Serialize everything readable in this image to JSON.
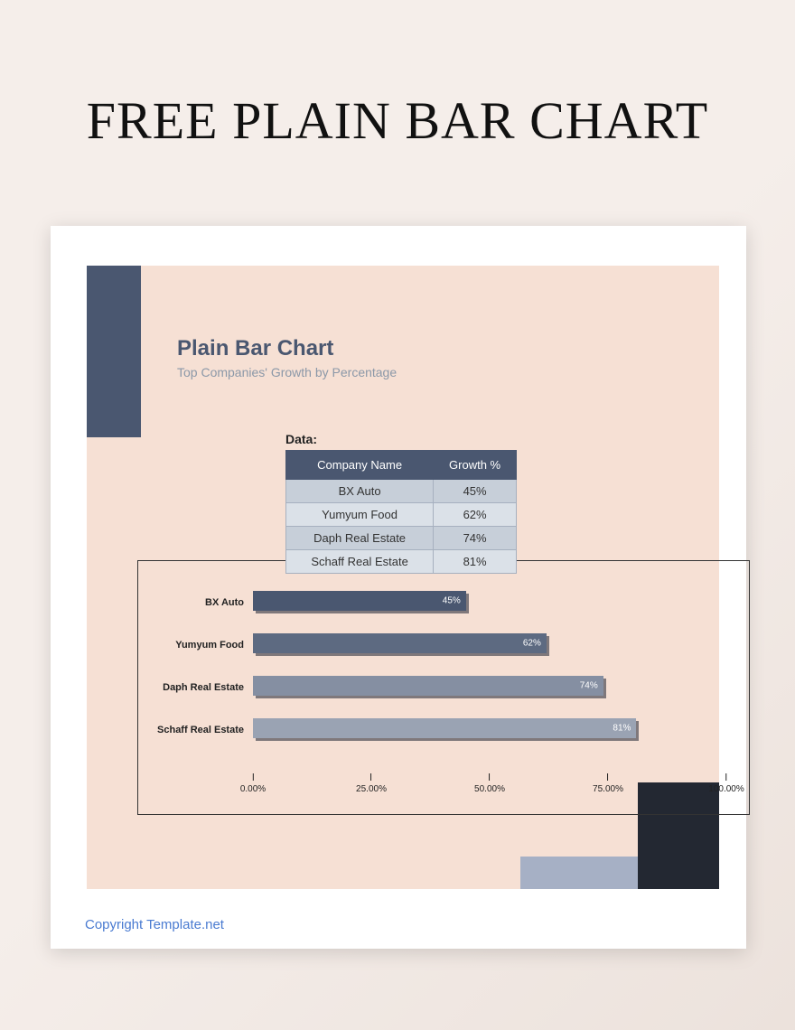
{
  "page_title": "FREE PLAIN BAR CHART",
  "header": {
    "title": "Plain Bar Chart",
    "subtitle": "Top Companies' Growth by Percentage"
  },
  "data_label": "Data:",
  "table": {
    "head_name": "Company Name",
    "head_growth": "Growth %",
    "rows": [
      {
        "name": "BX Auto",
        "growth": "45%"
      },
      {
        "name": "Yumyum Food",
        "growth": "62%"
      },
      {
        "name": "Daph Real Estate",
        "growth": "74%"
      },
      {
        "name": "Schaff Real Estate",
        "growth": "81%"
      }
    ]
  },
  "chart_data": {
    "type": "bar",
    "orientation": "horizontal",
    "title": "Plain Bar Chart",
    "subtitle": "Top Companies' Growth by Percentage",
    "xlabel": "",
    "ylabel": "",
    "xlim": [
      0,
      100
    ],
    "categories": [
      "BX Auto",
      "Yumyum Food",
      "Daph Real Estate",
      "Schaff Real Estate"
    ],
    "values": [
      45,
      62,
      74,
      81
    ],
    "value_labels": [
      "45%",
      "62%",
      "74%",
      "81%"
    ],
    "bar_colors": [
      "#4a5770",
      "#5d6a81",
      "#858fa2",
      "#9aa3b3"
    ],
    "axis_ticks": [
      {
        "pos": 0,
        "label": "0.00%"
      },
      {
        "pos": 25,
        "label": "25.00%"
      },
      {
        "pos": 50,
        "label": "50.00%"
      },
      {
        "pos": 75,
        "label": "75.00%"
      },
      {
        "pos": 100,
        "label": "100.00%"
      }
    ]
  },
  "copyright": "Copyright Template.net"
}
